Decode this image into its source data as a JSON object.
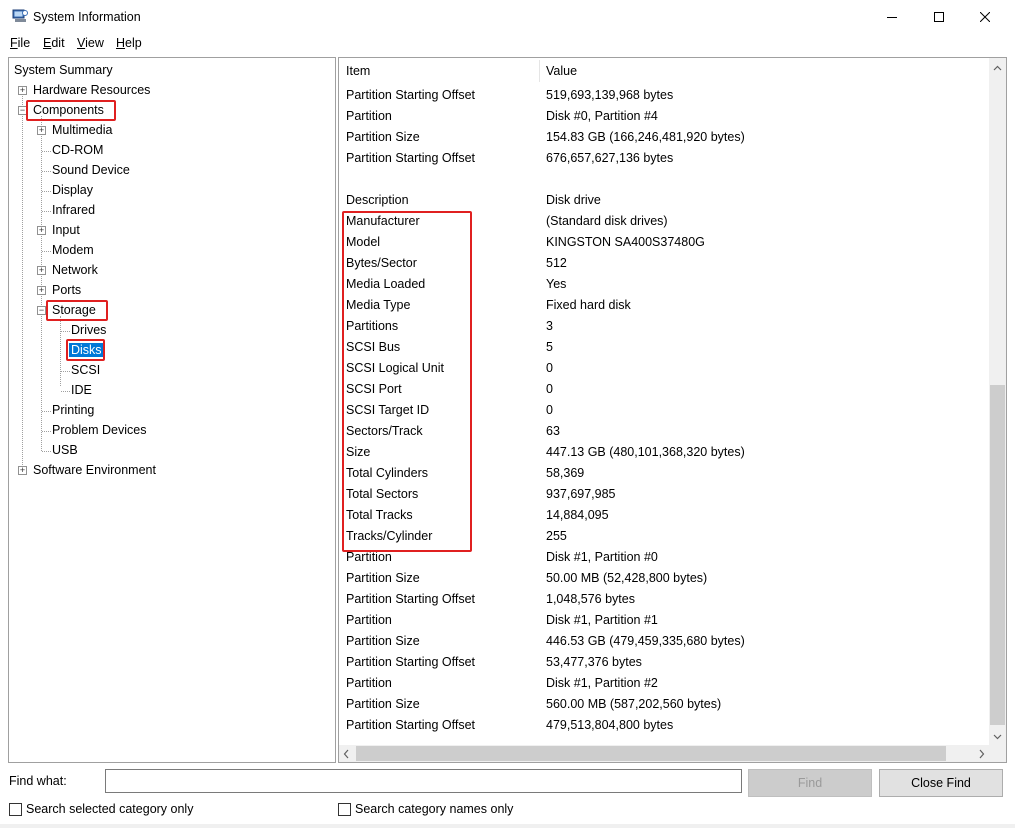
{
  "window": {
    "title": "System Information"
  },
  "menu": [
    {
      "label": "File",
      "accel": "F",
      "rest": "ile"
    },
    {
      "label": "Edit",
      "accel": "E",
      "rest": "dit"
    },
    {
      "label": "View",
      "accel": "V",
      "rest": "iew"
    },
    {
      "label": "Help",
      "accel": "H",
      "rest": "elp"
    }
  ],
  "tree": {
    "system_summary": "System Summary",
    "hardware_resources": "Hardware Resources",
    "components": "Components",
    "multimedia": "Multimedia",
    "cdrom": "CD-ROM",
    "sound_device": "Sound Device",
    "display": "Display",
    "infrared": "Infrared",
    "input": "Input",
    "modem": "Modem",
    "network": "Network",
    "ports": "Ports",
    "storage": "Storage",
    "drives": "Drives",
    "disks": "Disks",
    "scsi": "SCSI",
    "ide": "IDE",
    "printing": "Printing",
    "problem_devices": "Problem Devices",
    "usb": "USB",
    "software_environment": "Software Environment"
  },
  "list": {
    "header_item": "Item",
    "header_value": "Value",
    "rows": [
      {
        "item": "Partition Starting Offset",
        "value": "519,693,139,968 bytes"
      },
      {
        "item": "Partition",
        "value": "Disk #0, Partition #4"
      },
      {
        "item": "Partition Size",
        "value": "154.83 GB (166,246,481,920 bytes)"
      },
      {
        "item": "Partition Starting Offset",
        "value": "676,657,627,136 bytes"
      },
      {
        "item": "",
        "value": ""
      },
      {
        "item": "Description",
        "value": "Disk drive"
      },
      {
        "item": "Manufacturer",
        "value": "(Standard disk drives)"
      },
      {
        "item": "Model",
        "value": "KINGSTON SA400S37480G"
      },
      {
        "item": "Bytes/Sector",
        "value": "512"
      },
      {
        "item": "Media Loaded",
        "value": "Yes"
      },
      {
        "item": "Media Type",
        "value": "Fixed hard disk"
      },
      {
        "item": "Partitions",
        "value": "3"
      },
      {
        "item": "SCSI Bus",
        "value": "5"
      },
      {
        "item": "SCSI Logical Unit",
        "value": "0"
      },
      {
        "item": "SCSI Port",
        "value": "0"
      },
      {
        "item": "SCSI Target ID",
        "value": "0"
      },
      {
        "item": "Sectors/Track",
        "value": "63"
      },
      {
        "item": "Size",
        "value": "447.13 GB (480,101,368,320 bytes)"
      },
      {
        "item": "Total Cylinders",
        "value": "58,369"
      },
      {
        "item": "Total Sectors",
        "value": "937,697,985"
      },
      {
        "item": "Total Tracks",
        "value": "14,884,095"
      },
      {
        "item": "Tracks/Cylinder",
        "value": "255"
      },
      {
        "item": "Partition",
        "value": "Disk #1, Partition #0"
      },
      {
        "item": "Partition Size",
        "value": "50.00 MB (52,428,800 bytes)"
      },
      {
        "item": "Partition Starting Offset",
        "value": "1,048,576 bytes"
      },
      {
        "item": "Partition",
        "value": "Disk #1, Partition #1"
      },
      {
        "item": "Partition Size",
        "value": "446.53 GB (479,459,335,680 bytes)"
      },
      {
        "item": "Partition Starting Offset",
        "value": "53,477,376 bytes"
      },
      {
        "item": "Partition",
        "value": "Disk #1, Partition #2"
      },
      {
        "item": "Partition Size",
        "value": "560.00 MB (587,202,560 bytes)"
      },
      {
        "item": "Partition Starting Offset",
        "value": "479,513,804,800 bytes"
      }
    ]
  },
  "find": {
    "label": "Find what:",
    "value": "",
    "find_button": "Find",
    "close_button": "Close Find",
    "search_selected": "Search selected category only",
    "search_names": "Search category names only"
  },
  "colors": {
    "selection": "#0078d7",
    "highlight_box": "#e02020"
  }
}
